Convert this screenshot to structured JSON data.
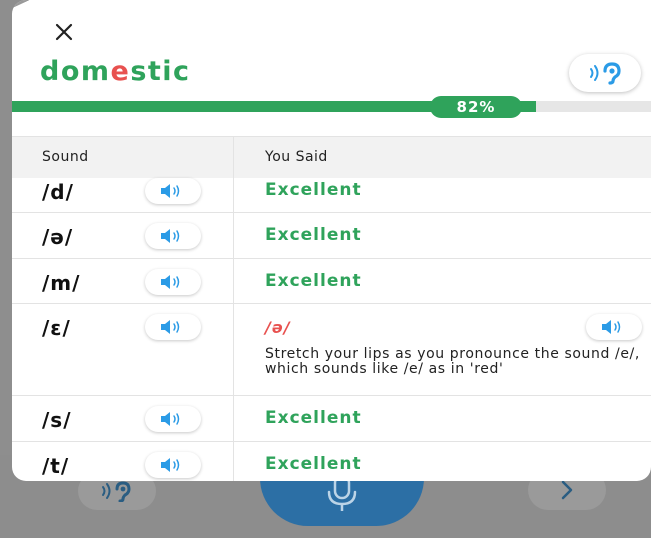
{
  "header": {
    "close_icon": "close-icon",
    "word_parts": [
      "dom",
      "e",
      "stic"
    ],
    "listen_icon": "ear-speaker-icon"
  },
  "progress": {
    "percent": 82,
    "label": "82%"
  },
  "table": {
    "col_sound": "Sound",
    "col_you_said": "You Said",
    "rows": [
      {
        "sound": "/d/",
        "result": "Excellent",
        "status": "good"
      },
      {
        "sound": "/ə/",
        "result": "Excellent",
        "status": "good"
      },
      {
        "sound": "/m/",
        "result": "Excellent",
        "status": "good"
      },
      {
        "sound": "/ɛ/",
        "result": "/ə/",
        "status": "bad",
        "tip": "Stretch your lips as you pronounce the sound /e/, which sounds like /e/ as in 'red'"
      },
      {
        "sound": "/s/",
        "result": "Excellent",
        "status": "good"
      },
      {
        "sound": "/t/",
        "result": "Excellent",
        "status": "good"
      }
    ]
  },
  "background": {
    "listen_icon": "ear-speaker-icon",
    "mic_icon": "microphone-icon",
    "next_icon": "chevron-right-icon"
  },
  "colors": {
    "good": "#2fa35b",
    "bad": "#e8514f",
    "speaker": "#2b9be6"
  }
}
